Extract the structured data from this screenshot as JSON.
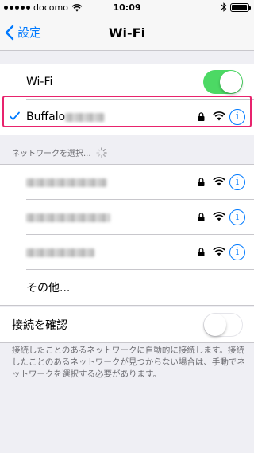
{
  "status_bar": {
    "carrier": "docomo",
    "time": "10:09",
    "battery_level": 0.95
  },
  "nav": {
    "back_label": "設定",
    "title": "Wi-Fi"
  },
  "wifi": {
    "label": "Wi-Fi",
    "enabled": true
  },
  "connected_network": {
    "name": "Buffalo",
    "secured": true
  },
  "choose_network": {
    "header": "ネットワークを選択...",
    "networks": [
      {
        "secured": true
      },
      {
        "secured": true
      },
      {
        "secured": true
      }
    ],
    "other_label": "その他..."
  },
  "ask_to_join": {
    "label": "接続を確認",
    "enabled": false,
    "description": "接続したことのあるネットワークに自動的に接続します。接続したことのあるネットワークが見つからない場合は、手動でネットワークを選択する必要があります。"
  },
  "colors": {
    "accent": "#007aff",
    "toggle_on": "#4cd964",
    "highlight": "#e8236d",
    "background": "#efeff4"
  }
}
